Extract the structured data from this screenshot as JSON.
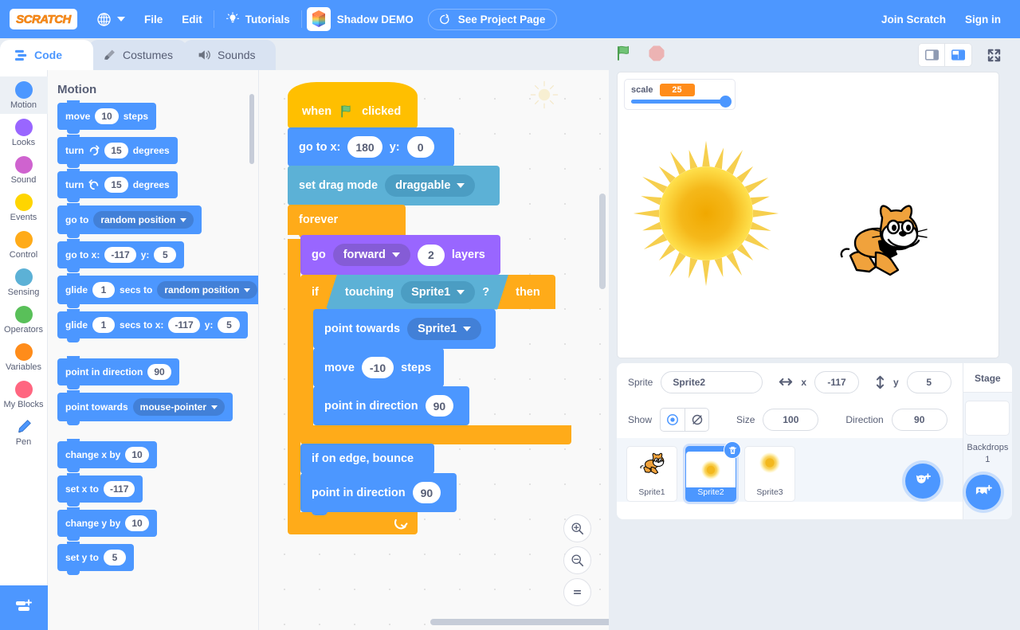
{
  "menubar": {
    "logo": "SCRATCH",
    "globe_icon": "globe-icon",
    "file": "File",
    "edit": "Edit",
    "tutorials": "Tutorials",
    "tutorials_icon": "lightbulb-icon",
    "project_title": "Shadow DEMO",
    "see_project_page": "See Project Page",
    "see_project_icon": "share-icon",
    "join_scratch": "Join Scratch",
    "sign_in": "Sign in",
    "accent": "#4d97ff"
  },
  "tabs": [
    {
      "label": "Code",
      "icon": "code-icon",
      "active": true
    },
    {
      "label": "Costumes",
      "icon": "paintbrush-icon",
      "active": false
    },
    {
      "label": "Sounds",
      "icon": "speaker-icon",
      "active": false
    }
  ],
  "categories": [
    {
      "label": "Motion",
      "color": "#4c97ff",
      "selected": true
    },
    {
      "label": "Looks",
      "color": "#9966ff",
      "selected": false
    },
    {
      "label": "Sound",
      "color": "#cf63cf",
      "selected": false
    },
    {
      "label": "Events",
      "color": "#ffd500",
      "selected": false
    },
    {
      "label": "Control",
      "color": "#ffab19",
      "selected": false
    },
    {
      "label": "Sensing",
      "color": "#5cb1d6",
      "selected": false
    },
    {
      "label": "Operators",
      "color": "#59c059",
      "selected": false
    },
    {
      "label": "Variables",
      "color": "#ff8c1a",
      "selected": false
    },
    {
      "label": "My Blocks",
      "color": "#ff6680",
      "selected": false
    },
    {
      "label": "Pen",
      "color": "#0fbd8c",
      "selected": false
    }
  ],
  "palette": {
    "heading": "Motion",
    "blocks": [
      {
        "id": "move",
        "parts": [
          {
            "t": "text",
            "v": "move"
          },
          {
            "t": "num",
            "v": "10"
          },
          {
            "t": "text",
            "v": "steps"
          }
        ]
      },
      {
        "id": "turn-right",
        "parts": [
          {
            "t": "text",
            "v": "turn"
          },
          {
            "t": "icon",
            "v": "turn-right-icon"
          },
          {
            "t": "num",
            "v": "15"
          },
          {
            "t": "text",
            "v": "degrees"
          }
        ]
      },
      {
        "id": "turn-left",
        "parts": [
          {
            "t": "text",
            "v": "turn"
          },
          {
            "t": "icon",
            "v": "turn-left-icon"
          },
          {
            "t": "num",
            "v": "15"
          },
          {
            "t": "text",
            "v": "degrees"
          }
        ]
      },
      {
        "id": "goto",
        "parts": [
          {
            "t": "text",
            "v": "go to"
          },
          {
            "t": "drop",
            "v": "random position"
          }
        ]
      },
      {
        "id": "gotoxy",
        "parts": [
          {
            "t": "text",
            "v": "go to x:"
          },
          {
            "t": "num",
            "v": "-117"
          },
          {
            "t": "text",
            "v": "y:"
          },
          {
            "t": "num",
            "v": "5"
          }
        ]
      },
      {
        "id": "glide-to",
        "parts": [
          {
            "t": "text",
            "v": "glide"
          },
          {
            "t": "num",
            "v": "1"
          },
          {
            "t": "text",
            "v": "secs to"
          },
          {
            "t": "drop",
            "v": "random position"
          }
        ]
      },
      {
        "id": "glide-xy",
        "parts": [
          {
            "t": "text",
            "v": "glide"
          },
          {
            "t": "num",
            "v": "1"
          },
          {
            "t": "text",
            "v": "secs to x:"
          },
          {
            "t": "num",
            "v": "-117"
          },
          {
            "t": "text",
            "v": "y:"
          },
          {
            "t": "num",
            "v": "5"
          }
        ]
      },
      {
        "id": "point-dir",
        "parts": [
          {
            "t": "text",
            "v": "point in direction"
          },
          {
            "t": "num",
            "v": "90"
          }
        ]
      },
      {
        "id": "point-towards",
        "parts": [
          {
            "t": "text",
            "v": "point towards"
          },
          {
            "t": "drop",
            "v": "mouse-pointer"
          }
        ]
      },
      {
        "id": "change-x",
        "parts": [
          {
            "t": "text",
            "v": "change x by"
          },
          {
            "t": "num",
            "v": "10"
          }
        ]
      },
      {
        "id": "set-x",
        "parts": [
          {
            "t": "text",
            "v": "set x to"
          },
          {
            "t": "num",
            "v": "-117"
          }
        ]
      },
      {
        "id": "change-y",
        "parts": [
          {
            "t": "text",
            "v": "change y by"
          },
          {
            "t": "num",
            "v": "10"
          }
        ]
      },
      {
        "id": "set-y",
        "parts": [
          {
            "t": "text",
            "v": "set y to"
          },
          {
            "t": "num",
            "v": "5"
          }
        ]
      }
    ]
  },
  "script": {
    "hat": {
      "pre": "when",
      "flag_icon": "green-flag-icon",
      "post": "clicked"
    },
    "gotoxy": {
      "l1": "go to x:",
      "x": "180",
      "l2": "y:",
      "y": "0"
    },
    "dragmode": {
      "label": "set drag mode",
      "value": "draggable"
    },
    "forever": {
      "label": "forever",
      "loop_icon": "loop-arrow-icon"
    },
    "golayers": {
      "l1": "go",
      "dir": "forward",
      "n": "2",
      "l2": "layers"
    },
    "if": {
      "l1": "if",
      "cond_label": "touching",
      "cond_target": "Sprite1",
      "q": "?",
      "l2": "then"
    },
    "point_towards": {
      "label": "point towards",
      "target": "Sprite1"
    },
    "move": {
      "l1": "move",
      "n": "-10",
      "l2": "steps"
    },
    "point_dir_in": {
      "label": "point in direction",
      "n": "90"
    },
    "bounce": {
      "label": "if on edge, bounce"
    },
    "point_dir_out": {
      "label": "point in direction",
      "n": "90"
    }
  },
  "zoom_controls": {
    "zoom_in": "zoom-in-icon",
    "zoom_out": "zoom-out-icon",
    "zoom_reset": "zoom-reset-icon"
  },
  "stage_controls": {
    "green_flag": "green-flag-icon",
    "stop": "stop-icon",
    "small_stage": "small-stage-icon",
    "large_stage": "large-stage-icon",
    "fullscreen": "fullscreen-icon"
  },
  "monitor": {
    "name": "scale",
    "value": "25",
    "slider_percent": 100
  },
  "sprite_info": {
    "sprite_label": "Sprite",
    "name": "Sprite2",
    "x_label": "x",
    "x": "-117",
    "y_label": "y",
    "y": "5",
    "show_label": "Show",
    "size_label": "Size",
    "size": "100",
    "direction_label": "Direction",
    "direction": "90",
    "show_icon": "eye-icon",
    "hide_icon": "eye-slash-icon"
  },
  "sprites": [
    {
      "name": "Sprite1",
      "thumb": "cat",
      "selected": false
    },
    {
      "name": "Sprite2",
      "thumb": "sun",
      "selected": true,
      "delete_icon": "trash-icon"
    },
    {
      "name": "Sprite3",
      "thumb": "sun",
      "selected": false
    }
  ],
  "stage_panel": {
    "header": "Stage",
    "backdrops_label": "Backdrops",
    "backdrops_count": "1"
  },
  "add_buttons": {
    "add_sprite": "add-sprite-icon",
    "add_backdrop": "add-backdrop-icon",
    "add_extension": "add-extension-icon"
  }
}
